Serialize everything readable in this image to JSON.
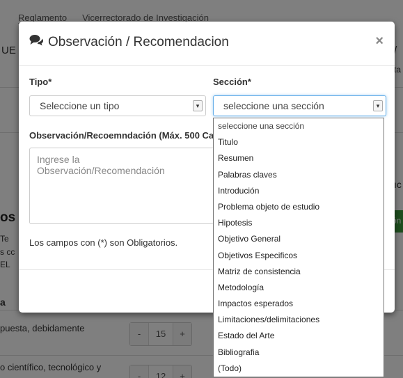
{
  "background": {
    "tabs": [
      "Reglamento",
      "Vicerrectorado de Investigación"
    ],
    "left_fragment": "UE",
    "right_fragment_1": "/",
    "right_fragment_2": "ta",
    "right_fragment_3": "ıc",
    "section_fragment": "os",
    "text_fragments": [
      "Te",
      "s cc",
      "EL",
      "a"
    ],
    "green_button_fragment": "ón",
    "rows": [
      {
        "label": "puesta, debidamente",
        "minus": "-",
        "value": "15",
        "plus": "+"
      },
      {
        "label": "o científico, tecnológico y",
        "minus": "-",
        "value": "12",
        "plus": "+"
      }
    ]
  },
  "modal": {
    "title": "Observación / Recomendacion",
    "close_label": "×",
    "tipo_label": "Tipo*",
    "tipo_value": "Seleccione un tipo",
    "seccion_label": "Sección*",
    "seccion_value": "seleccione una sección",
    "obs_label": "Observación/Recoemndación (Máx. 500 Ca",
    "obs_placeholder": "Ingrese la Observación/Recomendación",
    "note": "Los campos con (*) son Obligatorios."
  },
  "dropdown": {
    "options": [
      "seleccione una sección",
      "Titulo",
      "Resumen",
      "Palabras claves",
      "Introdución",
      "Problema objeto de estudio",
      "Hipotesis",
      "Objetivo General",
      "Objetivos Especificos",
      "Matriz de consistencia",
      "Metodología",
      "Impactos esperados",
      "Limitaciones/delimitaciones",
      "Estado del Arte",
      "Bibliografia",
      "(Todo)"
    ]
  }
}
